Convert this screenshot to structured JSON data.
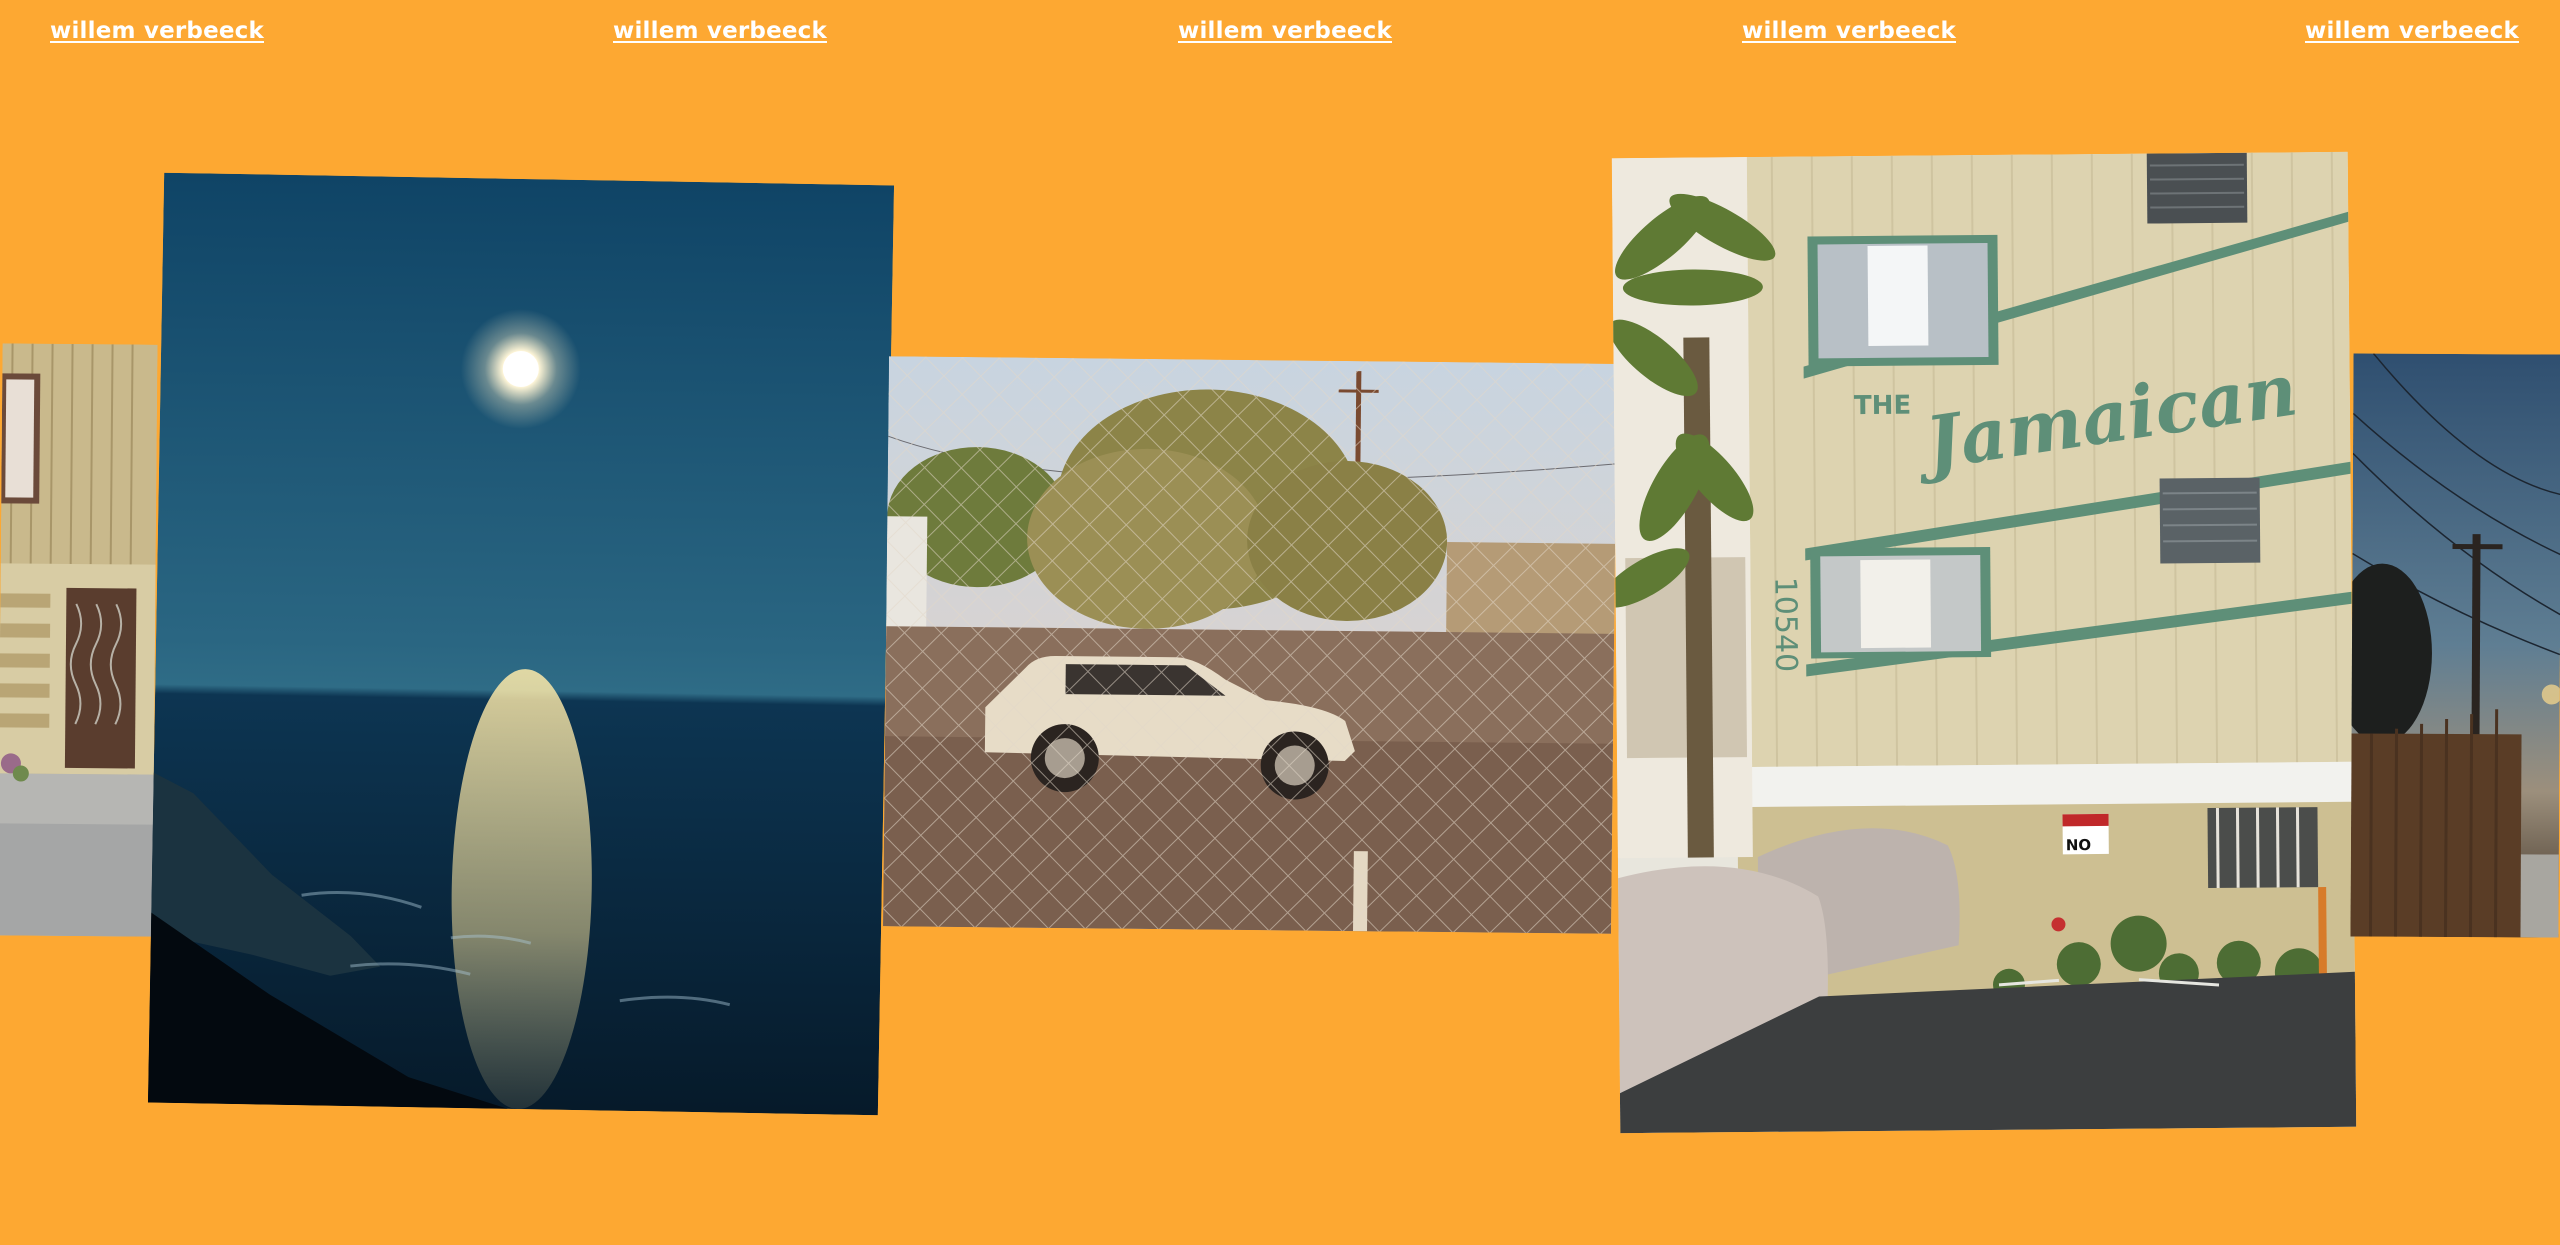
{
  "header": {
    "links": [
      "willem verbeeck",
      "willem verbeeck",
      "willem verbeeck",
      "willem verbeeck",
      "willem verbeeck"
    ]
  },
  "photos": {
    "house_edge": {
      "icon": "house-photo"
    },
    "moon_ocean": {
      "icon": "moon-over-ocean-photo"
    },
    "car_fence": {
      "icon": "car-behind-fence-photo"
    },
    "jamaican_building": {
      "icon": "apartment-building-photo",
      "sign_small": "THE",
      "sign_script": "Jamaican",
      "street_number": "10540",
      "notice_sign": "NO"
    },
    "street_edge": {
      "icon": "street-dusk-photo"
    }
  },
  "colors": {
    "background": "#FDA832",
    "link": "#FFFFFF",
    "building_trim": "#5E8F78"
  }
}
